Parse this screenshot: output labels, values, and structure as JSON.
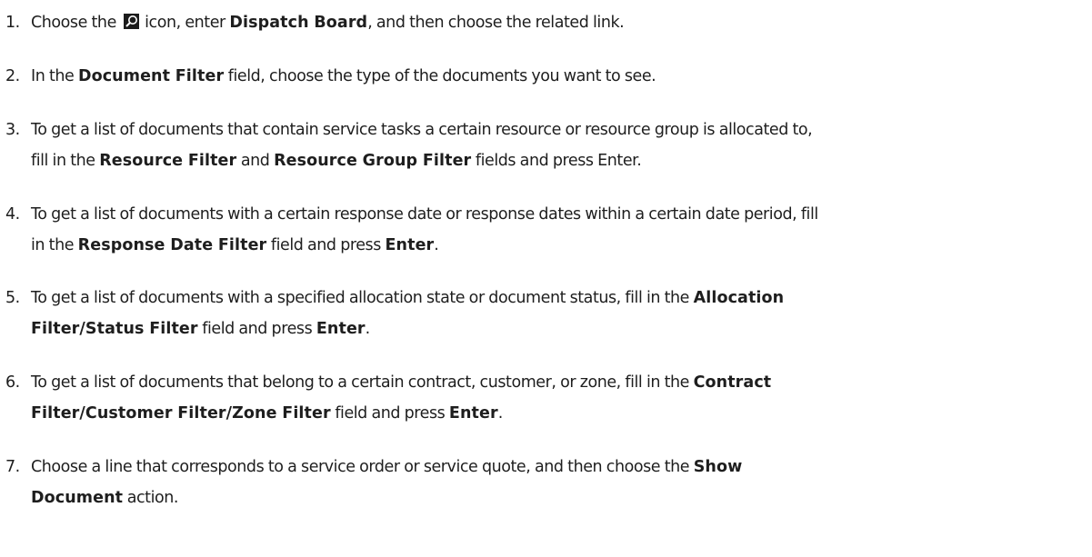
{
  "steps": [
    {
      "number": "1.",
      "parts": [
        "Choose the ",
        "icon",
        " icon, enter ",
        "Dispatch Board",
        ", and then choose the related link."
      ]
    },
    {
      "number": "2.",
      "parts": [
        "In the ",
        "Document Filter",
        " field, choose the type of the documents you want to see."
      ]
    },
    {
      "number": "3.",
      "line1": "To get a list of documents that contain service tasks a certain resource or resource group is allocated to,",
      "parts": [
        "fill in the ",
        "Resource Filter",
        " and ",
        "Resource Group Filter",
        " fields and press Enter."
      ]
    },
    {
      "number": "4.",
      "line1": "To get a list of documents with a certain response date or response dates within a certain date period, fill",
      "parts": [
        "in the ",
        "Response Date Filter",
        " field and press ",
        "Enter",
        "."
      ]
    },
    {
      "number": "5.",
      "line1a": "To get a list of documents with a specified allocation state or document status, fill in the ",
      "line1b": "Allocation",
      "parts": [
        "Filter/Status Filter",
        " field and press ",
        "Enter",
        "."
      ]
    },
    {
      "number": "6.",
      "line1a": "To get a list of documents that belong to a certain contract, customer, or zone, fill in the ",
      "line1b": "Contract",
      "parts": [
        "Filter/Customer Filter/Zone Filter",
        " field and press ",
        "Enter",
        "."
      ]
    },
    {
      "number": "7.",
      "line1a": "Choose a line that corresponds to a service order or service quote, and then choose the ",
      "line1b": "Show",
      "parts": [
        "Document",
        " action."
      ]
    }
  ],
  "icons": {
    "search": "search-icon"
  }
}
